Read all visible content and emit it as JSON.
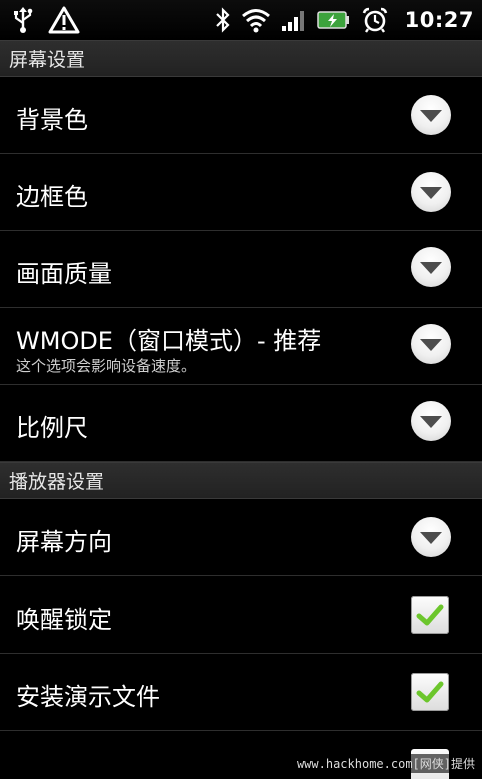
{
  "status_bar": {
    "icons_left": [
      "usb-icon",
      "warning-icon"
    ],
    "icons_right": [
      "bluetooth-icon",
      "wifi-icon",
      "signal-icon",
      "battery-charging-icon",
      "alarm-icon"
    ],
    "time": "10:27"
  },
  "sections": [
    {
      "header": "屏幕设置",
      "items": [
        {
          "title": "背景色",
          "control": "dropdown"
        },
        {
          "title": "边框色",
          "control": "dropdown"
        },
        {
          "title": "画面质量",
          "control": "dropdown"
        },
        {
          "title": "WMODE（窗口模式）- 推荐",
          "summary": "这个选项会影响设备速度。",
          "control": "dropdown"
        },
        {
          "title": "比例尺",
          "control": "dropdown"
        }
      ]
    },
    {
      "header": "播放器设置",
      "items": [
        {
          "title": "屏幕方向",
          "control": "dropdown"
        },
        {
          "title": "唤醒锁定",
          "control": "checkbox",
          "checked": true
        },
        {
          "title": "安装演示文件",
          "control": "checkbox",
          "checked": true
        }
      ]
    }
  ],
  "watermark": "www.hackhome.com[网侠]提供",
  "colors": {
    "background": "#000000",
    "header_bg": "#2a2a2a",
    "check_green": "#6cc62c"
  }
}
